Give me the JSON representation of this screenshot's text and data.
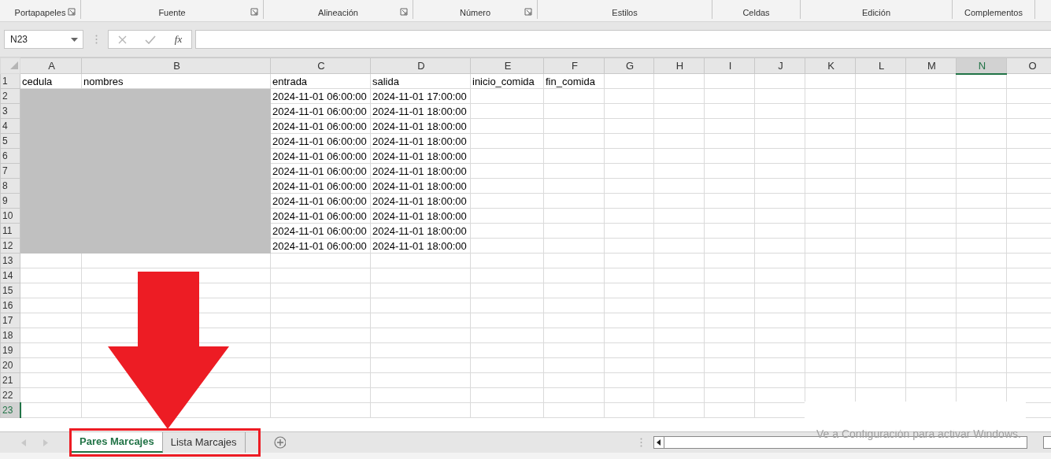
{
  "ribbon": {
    "groups": [
      {
        "label": "Portapapeles",
        "launcher": true
      },
      {
        "label": "Fuente",
        "launcher": true
      },
      {
        "label": "Alineación",
        "launcher": true
      },
      {
        "label": "Número",
        "launcher": true
      },
      {
        "label": "Estilos",
        "launcher": false
      },
      {
        "label": "Celdas",
        "launcher": false
      },
      {
        "label": "Edición",
        "launcher": false
      },
      {
        "label": "Complementos",
        "launcher": false
      }
    ]
  },
  "formula_bar": {
    "name_box": "N23",
    "function_button": "fx"
  },
  "sheet": {
    "columns": [
      {
        "label": "A",
        "selected": false
      },
      {
        "label": "B",
        "selected": false
      },
      {
        "label": "C",
        "selected": false
      },
      {
        "label": "D",
        "selected": false
      },
      {
        "label": "E",
        "selected": false
      },
      {
        "label": "F",
        "selected": false
      },
      {
        "label": "G",
        "selected": false
      },
      {
        "label": "H",
        "selected": false
      },
      {
        "label": "I",
        "selected": false
      },
      {
        "label": "J",
        "selected": false
      },
      {
        "label": "K",
        "selected": false
      },
      {
        "label": "L",
        "selected": false
      },
      {
        "label": "M",
        "selected": false
      },
      {
        "label": "N",
        "selected": true
      },
      {
        "label": "O",
        "selected": false
      }
    ],
    "rows": [
      {
        "header": "1",
        "selected": false,
        "redacted": false,
        "cells": [
          "cedula",
          "nombres",
          "entrada",
          "salida",
          "inicio_comida",
          "fin_comida"
        ]
      },
      {
        "header": "2",
        "selected": false,
        "redacted": true,
        "cells": [
          null,
          null,
          "2024-11-01 06:00:00",
          "2024-11-01 17:00:00"
        ]
      },
      {
        "header": "3",
        "selected": false,
        "redacted": true,
        "cells": [
          null,
          null,
          "2024-11-01 06:00:00",
          "2024-11-01 18:00:00"
        ]
      },
      {
        "header": "4",
        "selected": false,
        "redacted": true,
        "cells": [
          null,
          null,
          "2024-11-01 06:00:00",
          "2024-11-01 18:00:00"
        ]
      },
      {
        "header": "5",
        "selected": false,
        "redacted": true,
        "cells": [
          null,
          null,
          "2024-11-01 06:00:00",
          "2024-11-01 18:00:00"
        ]
      },
      {
        "header": "6",
        "selected": false,
        "redacted": true,
        "cells": [
          null,
          null,
          "2024-11-01 06:00:00",
          "2024-11-01 18:00:00"
        ]
      },
      {
        "header": "7",
        "selected": false,
        "redacted": true,
        "cells": [
          null,
          null,
          "2024-11-01 06:00:00",
          "2024-11-01 18:00:00"
        ]
      },
      {
        "header": "8",
        "selected": false,
        "redacted": true,
        "cells": [
          null,
          null,
          "2024-11-01 06:00:00",
          "2024-11-01 18:00:00"
        ]
      },
      {
        "header": "9",
        "selected": false,
        "redacted": true,
        "cells": [
          null,
          null,
          "2024-11-01 06:00:00",
          "2024-11-01 18:00:00"
        ]
      },
      {
        "header": "10",
        "selected": false,
        "redacted": true,
        "cells": [
          null,
          null,
          "2024-11-01 06:00:00",
          "2024-11-01 18:00:00"
        ]
      },
      {
        "header": "11",
        "selected": false,
        "redacted": true,
        "cells": [
          null,
          null,
          "2024-11-01 06:00:00",
          "2024-11-01 18:00:00"
        ]
      },
      {
        "header": "12",
        "selected": false,
        "redacted": true,
        "cells": [
          null,
          null,
          "2024-11-01 06:00:00",
          "2024-11-01 18:00:00"
        ]
      },
      {
        "header": "13",
        "selected": false,
        "redacted": false
      },
      {
        "header": "14",
        "selected": false,
        "redacted": false
      },
      {
        "header": "15",
        "selected": false,
        "redacted": false
      },
      {
        "header": "16",
        "selected": false,
        "redacted": false
      },
      {
        "header": "17",
        "selected": false,
        "redacted": false
      },
      {
        "header": "18",
        "selected": false,
        "redacted": false
      },
      {
        "header": "19",
        "selected": false,
        "redacted": false
      },
      {
        "header": "20",
        "selected": false,
        "redacted": false
      },
      {
        "header": "21",
        "selected": false,
        "redacted": false
      },
      {
        "header": "22",
        "selected": false,
        "redacted": false
      },
      {
        "header": "23",
        "selected": true,
        "redacted": false
      }
    ]
  },
  "sheet_tabs": [
    {
      "label": "Pares Marcajes",
      "selected": true
    },
    {
      "label": "Lista Marcajes",
      "selected": false
    }
  ],
  "activation_notice": "Ve a Configuración para activar Windows.",
  "arrow_annotation": true,
  "frame_annotation": true
}
